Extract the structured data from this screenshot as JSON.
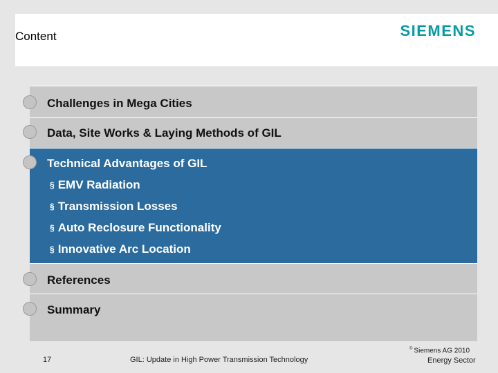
{
  "header": {
    "title": "Content",
    "logo": "SIEMENS"
  },
  "agenda": {
    "items": [
      {
        "label": "Challenges in Mega Cities"
      },
      {
        "label": "Data, Site Works & Laying Methods of GIL"
      },
      {
        "label": "Technical Advantages of GIL",
        "subitems": [
          {
            "marker": "§",
            "label": "EMV Radiation"
          },
          {
            "marker": "§",
            "label": "Transmission Losses"
          },
          {
            "marker": "§",
            "label": "Auto Reclosure Functionality"
          },
          {
            "marker": "§",
            "label": "Innovative Arc Location"
          }
        ]
      },
      {
        "label": "References"
      },
      {
        "label": "Summary"
      }
    ]
  },
  "footer": {
    "page_number": "17",
    "presentation_title": "GIL: Update in High Power Transmission Technology",
    "copyright_symbol": "©",
    "copyright": "Siemens AG 2010",
    "sector": "Energy Sector"
  },
  "colors": {
    "accent": "#2b6b9e",
    "brand": "#069aa6",
    "item_background": "#c8c8c8"
  }
}
